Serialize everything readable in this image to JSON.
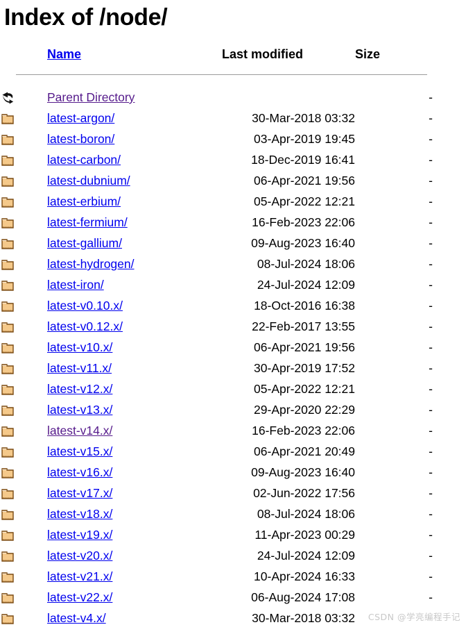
{
  "page": {
    "title": "Index of /node/",
    "watermark": "CSDN @学亮编程手记"
  },
  "columns": {
    "icon": "",
    "name": "Name",
    "last_modified": "Last modified",
    "size": "Size"
  },
  "colors": {
    "link": "#0000ee",
    "visited_link": "#551a8b",
    "text": "#000000",
    "rule": "#9a9a9a",
    "folder_fill": "#f5c98a",
    "folder_outline": "#7a4a12",
    "watermark": "#c8c8c8",
    "background": "#ffffff"
  },
  "rows": [
    {
      "icon": "back-arrow-icon",
      "name": "Parent Directory",
      "visited": true,
      "last_modified": "",
      "size": "-"
    },
    {
      "icon": "folder-icon",
      "name": "latest-argon/",
      "visited": false,
      "last_modified": "30-Mar-2018 03:32",
      "size": "-"
    },
    {
      "icon": "folder-icon",
      "name": "latest-boron/",
      "visited": false,
      "last_modified": "03-Apr-2019 19:45",
      "size": "-"
    },
    {
      "icon": "folder-icon",
      "name": "latest-carbon/",
      "visited": false,
      "last_modified": "18-Dec-2019 16:41",
      "size": "-"
    },
    {
      "icon": "folder-icon",
      "name": "latest-dubnium/",
      "visited": false,
      "last_modified": "06-Apr-2021 19:56",
      "size": "-"
    },
    {
      "icon": "folder-icon",
      "name": "latest-erbium/",
      "visited": false,
      "last_modified": "05-Apr-2022 12:21",
      "size": "-"
    },
    {
      "icon": "folder-icon",
      "name": "latest-fermium/",
      "visited": false,
      "last_modified": "16-Feb-2023 22:06",
      "size": "-"
    },
    {
      "icon": "folder-icon",
      "name": "latest-gallium/",
      "visited": false,
      "last_modified": "09-Aug-2023 16:40",
      "size": "-"
    },
    {
      "icon": "folder-icon",
      "name": "latest-hydrogen/",
      "visited": false,
      "last_modified": "08-Jul-2024 18:06",
      "size": "-"
    },
    {
      "icon": "folder-icon",
      "name": "latest-iron/",
      "visited": false,
      "last_modified": "24-Jul-2024 12:09",
      "size": "-"
    },
    {
      "icon": "folder-icon",
      "name": "latest-v0.10.x/",
      "visited": false,
      "last_modified": "18-Oct-2016 16:38",
      "size": "-"
    },
    {
      "icon": "folder-icon",
      "name": "latest-v0.12.x/",
      "visited": false,
      "last_modified": "22-Feb-2017 13:55",
      "size": "-"
    },
    {
      "icon": "folder-icon",
      "name": "latest-v10.x/",
      "visited": false,
      "last_modified": "06-Apr-2021 19:56",
      "size": "-"
    },
    {
      "icon": "folder-icon",
      "name": "latest-v11.x/",
      "visited": false,
      "last_modified": "30-Apr-2019 17:52",
      "size": "-"
    },
    {
      "icon": "folder-icon",
      "name": "latest-v12.x/",
      "visited": false,
      "last_modified": "05-Apr-2022 12:21",
      "size": "-"
    },
    {
      "icon": "folder-icon",
      "name": "latest-v13.x/",
      "visited": false,
      "last_modified": "29-Apr-2020 22:29",
      "size": "-"
    },
    {
      "icon": "folder-icon",
      "name": "latest-v14.x/",
      "visited": true,
      "last_modified": "16-Feb-2023 22:06",
      "size": "-"
    },
    {
      "icon": "folder-icon",
      "name": "latest-v15.x/",
      "visited": false,
      "last_modified": "06-Apr-2021 20:49",
      "size": "-"
    },
    {
      "icon": "folder-icon",
      "name": "latest-v16.x/",
      "visited": false,
      "last_modified": "09-Aug-2023 16:40",
      "size": "-"
    },
    {
      "icon": "folder-icon",
      "name": "latest-v17.x/",
      "visited": false,
      "last_modified": "02-Jun-2022 17:56",
      "size": "-"
    },
    {
      "icon": "folder-icon",
      "name": "latest-v18.x/",
      "visited": false,
      "last_modified": "08-Jul-2024 18:06",
      "size": "-"
    },
    {
      "icon": "folder-icon",
      "name": "latest-v19.x/",
      "visited": false,
      "last_modified": "11-Apr-2023 00:29",
      "size": "-"
    },
    {
      "icon": "folder-icon",
      "name": "latest-v20.x/",
      "visited": false,
      "last_modified": "24-Jul-2024 12:09",
      "size": "-"
    },
    {
      "icon": "folder-icon",
      "name": "latest-v21.x/",
      "visited": false,
      "last_modified": "10-Apr-2024 16:33",
      "size": "-"
    },
    {
      "icon": "folder-icon",
      "name": "latest-v22.x/",
      "visited": false,
      "last_modified": "06-Aug-2024 17:08",
      "size": "-"
    },
    {
      "icon": "folder-icon",
      "name": "latest-v4.x/",
      "visited": false,
      "last_modified": "30-Mar-2018 03:32",
      "size": ""
    }
  ]
}
